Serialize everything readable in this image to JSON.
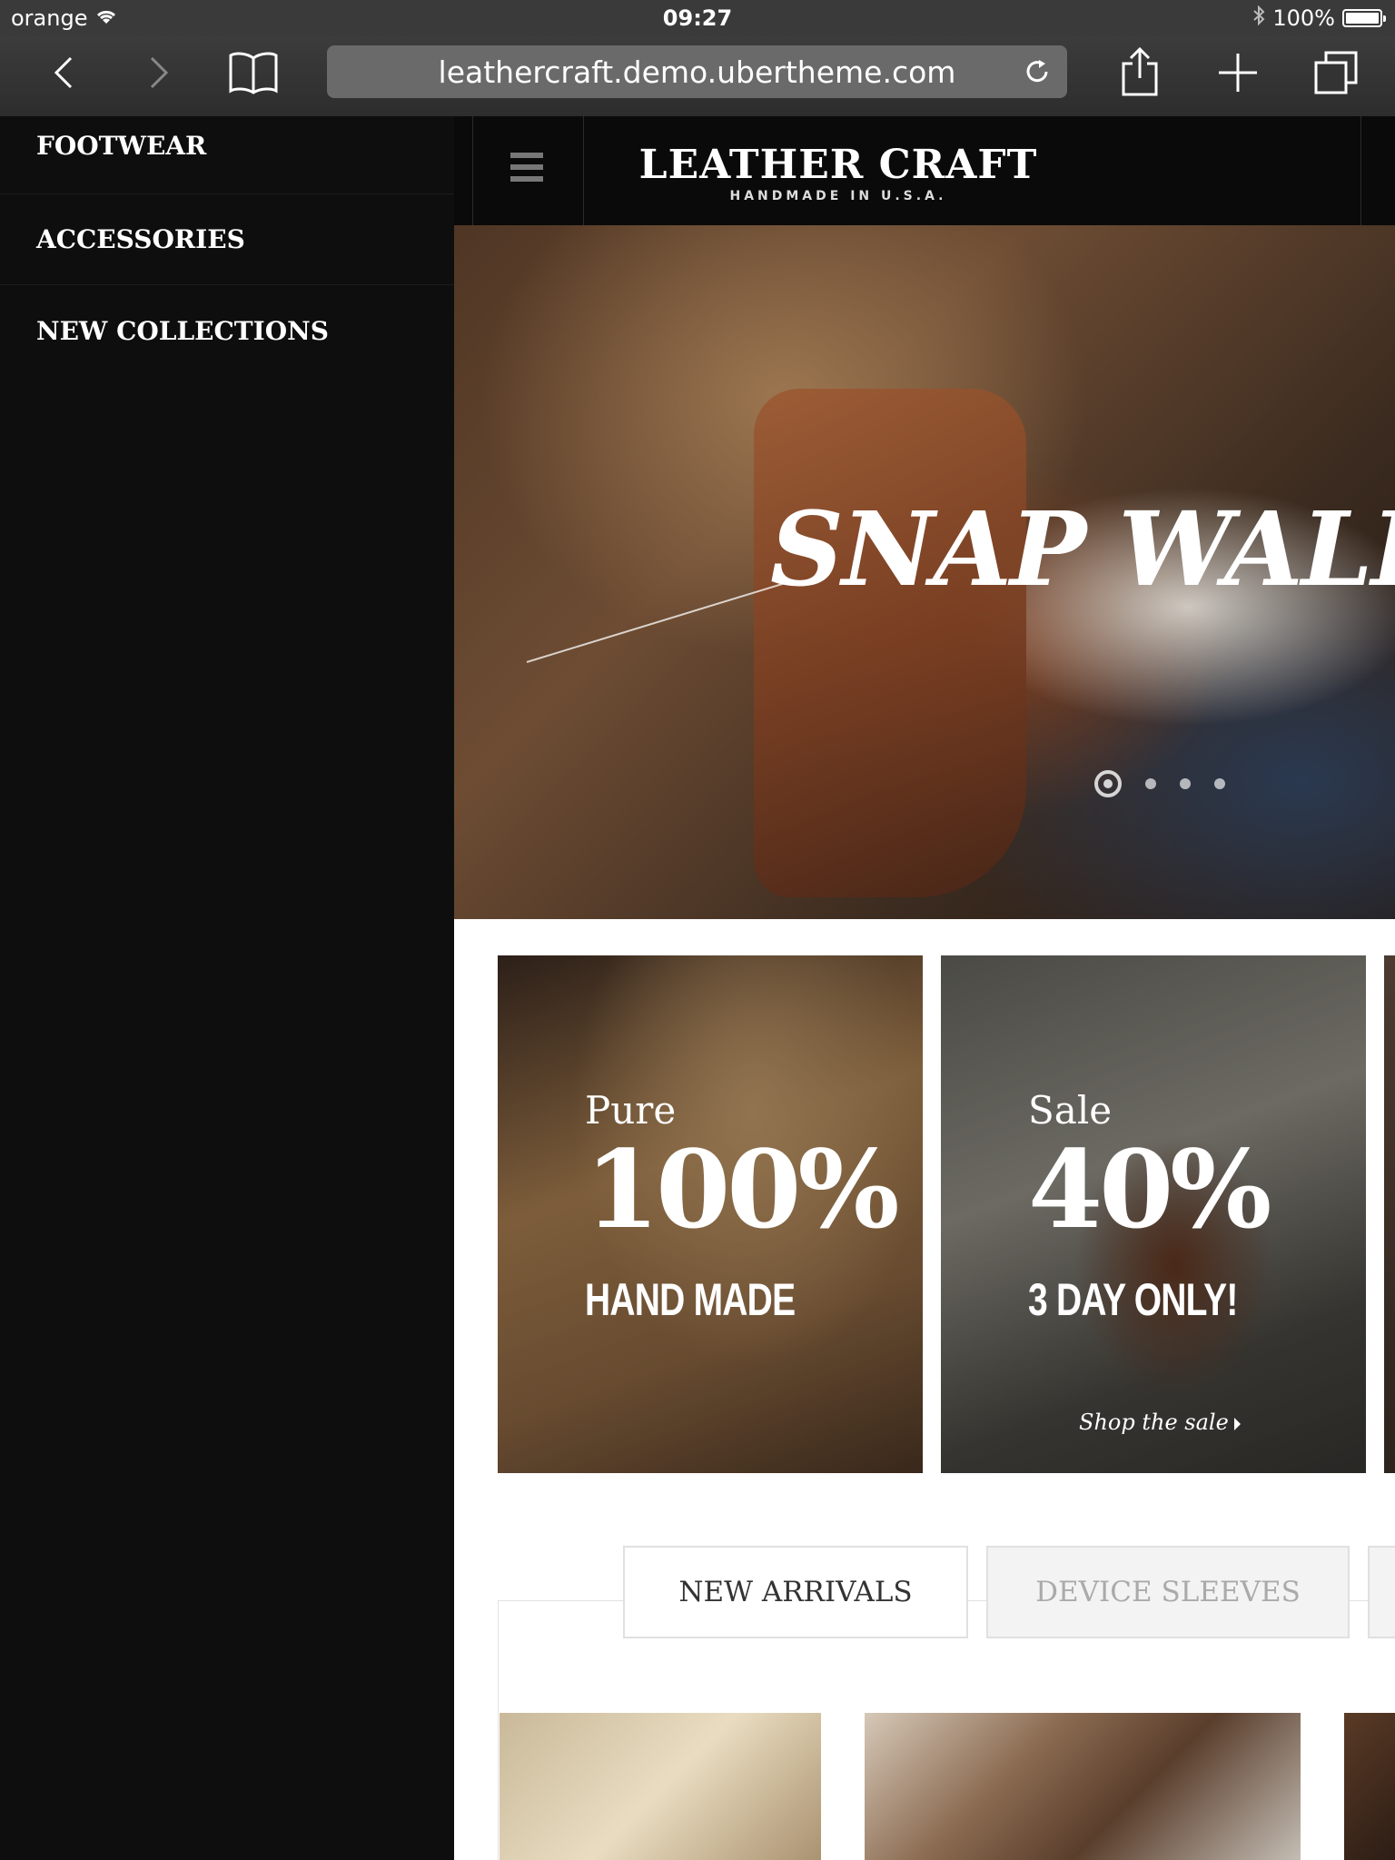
{
  "status_bar": {
    "signal_dots": "●●●○○",
    "carrier": "orange",
    "time": "09:27",
    "battery": "100%",
    "icons": [
      "wifi-icon",
      "bluetooth-icon",
      "battery-icon"
    ]
  },
  "browser": {
    "url": "leathercraft.demo.ubertheme.com",
    "icons": [
      "back-icon",
      "forward-icon",
      "bookmarks-icon",
      "reload-icon",
      "share-icon",
      "new-tab-icon",
      "tabs-icon"
    ]
  },
  "side_menu": {
    "items": [
      {
        "label": "FOOTWEAR"
      },
      {
        "label": "ACCESSORIES"
      },
      {
        "label": "NEW COLLECTIONS"
      }
    ]
  },
  "header": {
    "logo_name": "LEATHER CRAFT",
    "logo_tagline": "HANDMADE IN U.S.A."
  },
  "hero": {
    "title": "SNAP WALL",
    "slide_count": 4,
    "active_slide": 1
  },
  "promos": [
    {
      "small": "Pure",
      "big": "100%",
      "sub": "HAND MADE"
    },
    {
      "small": "Sale",
      "big": "40%",
      "sub": "3 DAY ONLY!",
      "link": "Shop the sale"
    }
  ],
  "tabs": [
    {
      "label": "NEW ARRIVALS",
      "active": true
    },
    {
      "label": "DEVICE SLEEVES",
      "active": false
    }
  ],
  "colors": {
    "menu_bg": "#0e0e0e",
    "header_bg": "#0a0a0a",
    "browser_chrome": "#333333"
  }
}
